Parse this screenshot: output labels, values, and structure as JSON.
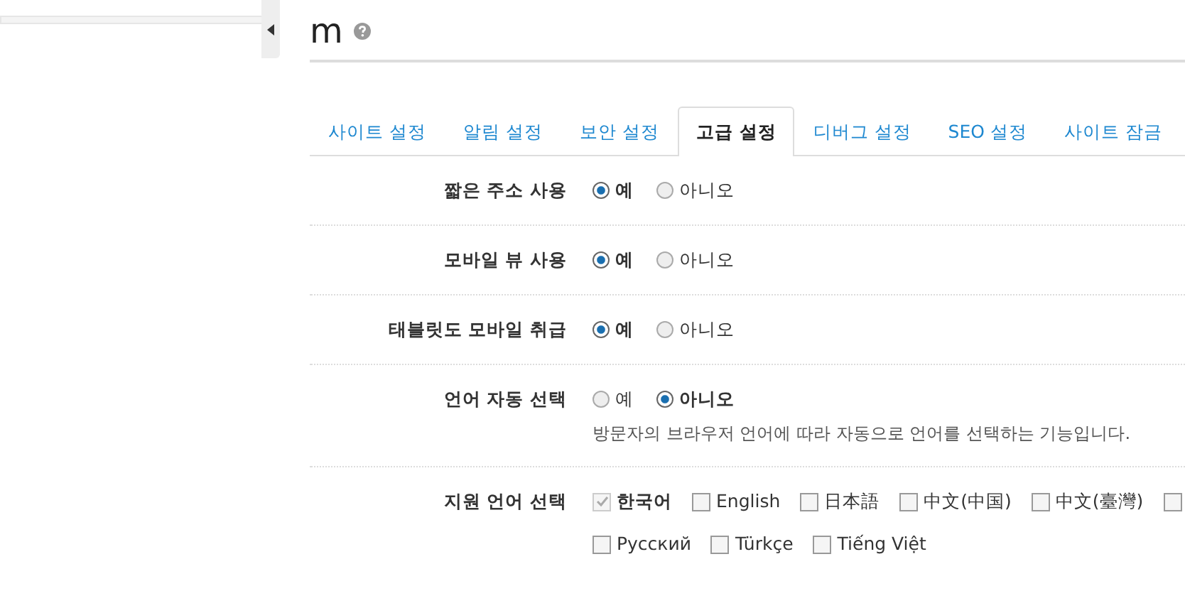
{
  "title": "m",
  "tabs": [
    {
      "label": "사이트 설정",
      "selected": false
    },
    {
      "label": "알림 설정",
      "selected": false
    },
    {
      "label": "보안 설정",
      "selected": false
    },
    {
      "label": "고급 설정",
      "selected": true
    },
    {
      "label": "디버그 설정",
      "selected": false
    },
    {
      "label": "SEO 설정",
      "selected": false
    },
    {
      "label": "사이트 잠금",
      "selected": false
    }
  ],
  "settings": [
    {
      "kind": "radio",
      "label": "짧은 주소 사용",
      "options": [
        {
          "label": "예",
          "selected": true
        },
        {
          "label": "아니오",
          "selected": false
        }
      ]
    },
    {
      "kind": "radio",
      "label": "모바일 뷰 사용",
      "options": [
        {
          "label": "예",
          "selected": true
        },
        {
          "label": "아니오",
          "selected": false
        }
      ]
    },
    {
      "kind": "radio",
      "label": "태블릿도 모바일 취급",
      "options": [
        {
          "label": "예",
          "selected": true
        },
        {
          "label": "아니오",
          "selected": false
        }
      ]
    },
    {
      "kind": "radio",
      "label": "언어 자동 선택",
      "options": [
        {
          "label": "예",
          "selected": false
        },
        {
          "label": "아니오",
          "selected": true
        }
      ],
      "description": "방문자의 브라우저 언어에 따라 자동으로 언어를 선택하는 기능입니다."
    },
    {
      "kind": "checkbox",
      "label": "지원 언어 선택",
      "options": [
        {
          "label": "한국어",
          "checked": true,
          "disabled": true
        },
        {
          "label": "English",
          "checked": false,
          "disabled": false
        },
        {
          "label": "日本語",
          "checked": false,
          "disabled": false
        },
        {
          "label": "中文(中国)",
          "checked": false,
          "disabled": false
        },
        {
          "label": "中文(臺灣)",
          "checked": false,
          "disabled": false
        },
        {
          "checked": false,
          "disabled": false
        },
        {
          "label": "Русский",
          "checked": false,
          "disabled": false
        },
        {
          "label": "Türkçe",
          "checked": false,
          "disabled": false
        },
        {
          "label": "Tiếng Việt",
          "checked": false,
          "disabled": false
        }
      ]
    }
  ]
}
